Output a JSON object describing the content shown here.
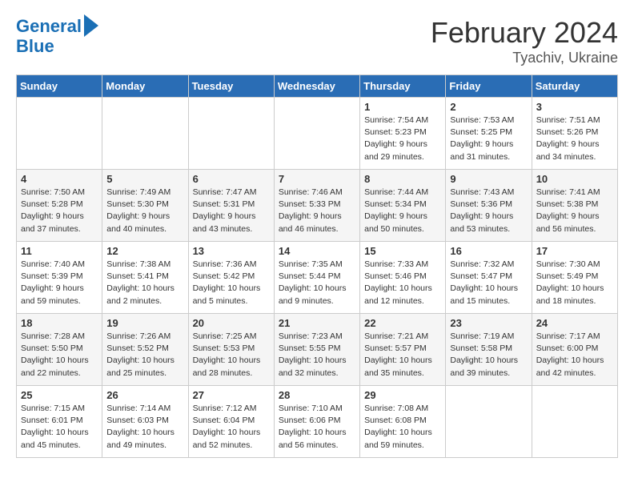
{
  "header": {
    "logo_line1": "General",
    "logo_line2": "Blue",
    "title": "February 2024",
    "subtitle": "Tyachiv, Ukraine"
  },
  "calendar": {
    "days_of_week": [
      "Sunday",
      "Monday",
      "Tuesday",
      "Wednesday",
      "Thursday",
      "Friday",
      "Saturday"
    ],
    "weeks": [
      [
        {
          "day": "",
          "info": ""
        },
        {
          "day": "",
          "info": ""
        },
        {
          "day": "",
          "info": ""
        },
        {
          "day": "",
          "info": ""
        },
        {
          "day": "1",
          "info": "Sunrise: 7:54 AM\nSunset: 5:23 PM\nDaylight: 9 hours\nand 29 minutes."
        },
        {
          "day": "2",
          "info": "Sunrise: 7:53 AM\nSunset: 5:25 PM\nDaylight: 9 hours\nand 31 minutes."
        },
        {
          "day": "3",
          "info": "Sunrise: 7:51 AM\nSunset: 5:26 PM\nDaylight: 9 hours\nand 34 minutes."
        }
      ],
      [
        {
          "day": "4",
          "info": "Sunrise: 7:50 AM\nSunset: 5:28 PM\nDaylight: 9 hours\nand 37 minutes."
        },
        {
          "day": "5",
          "info": "Sunrise: 7:49 AM\nSunset: 5:30 PM\nDaylight: 9 hours\nand 40 minutes."
        },
        {
          "day": "6",
          "info": "Sunrise: 7:47 AM\nSunset: 5:31 PM\nDaylight: 9 hours\nand 43 minutes."
        },
        {
          "day": "7",
          "info": "Sunrise: 7:46 AM\nSunset: 5:33 PM\nDaylight: 9 hours\nand 46 minutes."
        },
        {
          "day": "8",
          "info": "Sunrise: 7:44 AM\nSunset: 5:34 PM\nDaylight: 9 hours\nand 50 minutes."
        },
        {
          "day": "9",
          "info": "Sunrise: 7:43 AM\nSunset: 5:36 PM\nDaylight: 9 hours\nand 53 minutes."
        },
        {
          "day": "10",
          "info": "Sunrise: 7:41 AM\nSunset: 5:38 PM\nDaylight: 9 hours\nand 56 minutes."
        }
      ],
      [
        {
          "day": "11",
          "info": "Sunrise: 7:40 AM\nSunset: 5:39 PM\nDaylight: 9 hours\nand 59 minutes."
        },
        {
          "day": "12",
          "info": "Sunrise: 7:38 AM\nSunset: 5:41 PM\nDaylight: 10 hours\nand 2 minutes."
        },
        {
          "day": "13",
          "info": "Sunrise: 7:36 AM\nSunset: 5:42 PM\nDaylight: 10 hours\nand 5 minutes."
        },
        {
          "day": "14",
          "info": "Sunrise: 7:35 AM\nSunset: 5:44 PM\nDaylight: 10 hours\nand 9 minutes."
        },
        {
          "day": "15",
          "info": "Sunrise: 7:33 AM\nSunset: 5:46 PM\nDaylight: 10 hours\nand 12 minutes."
        },
        {
          "day": "16",
          "info": "Sunrise: 7:32 AM\nSunset: 5:47 PM\nDaylight: 10 hours\nand 15 minutes."
        },
        {
          "day": "17",
          "info": "Sunrise: 7:30 AM\nSunset: 5:49 PM\nDaylight: 10 hours\nand 18 minutes."
        }
      ],
      [
        {
          "day": "18",
          "info": "Sunrise: 7:28 AM\nSunset: 5:50 PM\nDaylight: 10 hours\nand 22 minutes."
        },
        {
          "day": "19",
          "info": "Sunrise: 7:26 AM\nSunset: 5:52 PM\nDaylight: 10 hours\nand 25 minutes."
        },
        {
          "day": "20",
          "info": "Sunrise: 7:25 AM\nSunset: 5:53 PM\nDaylight: 10 hours\nand 28 minutes."
        },
        {
          "day": "21",
          "info": "Sunrise: 7:23 AM\nSunset: 5:55 PM\nDaylight: 10 hours\nand 32 minutes."
        },
        {
          "day": "22",
          "info": "Sunrise: 7:21 AM\nSunset: 5:57 PM\nDaylight: 10 hours\nand 35 minutes."
        },
        {
          "day": "23",
          "info": "Sunrise: 7:19 AM\nSunset: 5:58 PM\nDaylight: 10 hours\nand 39 minutes."
        },
        {
          "day": "24",
          "info": "Sunrise: 7:17 AM\nSunset: 6:00 PM\nDaylight: 10 hours\nand 42 minutes."
        }
      ],
      [
        {
          "day": "25",
          "info": "Sunrise: 7:15 AM\nSunset: 6:01 PM\nDaylight: 10 hours\nand 45 minutes."
        },
        {
          "day": "26",
          "info": "Sunrise: 7:14 AM\nSunset: 6:03 PM\nDaylight: 10 hours\nand 49 minutes."
        },
        {
          "day": "27",
          "info": "Sunrise: 7:12 AM\nSunset: 6:04 PM\nDaylight: 10 hours\nand 52 minutes."
        },
        {
          "day": "28",
          "info": "Sunrise: 7:10 AM\nSunset: 6:06 PM\nDaylight: 10 hours\nand 56 minutes."
        },
        {
          "day": "29",
          "info": "Sunrise: 7:08 AM\nSunset: 6:08 PM\nDaylight: 10 hours\nand 59 minutes."
        },
        {
          "day": "",
          "info": ""
        },
        {
          "day": "",
          "info": ""
        }
      ]
    ]
  }
}
